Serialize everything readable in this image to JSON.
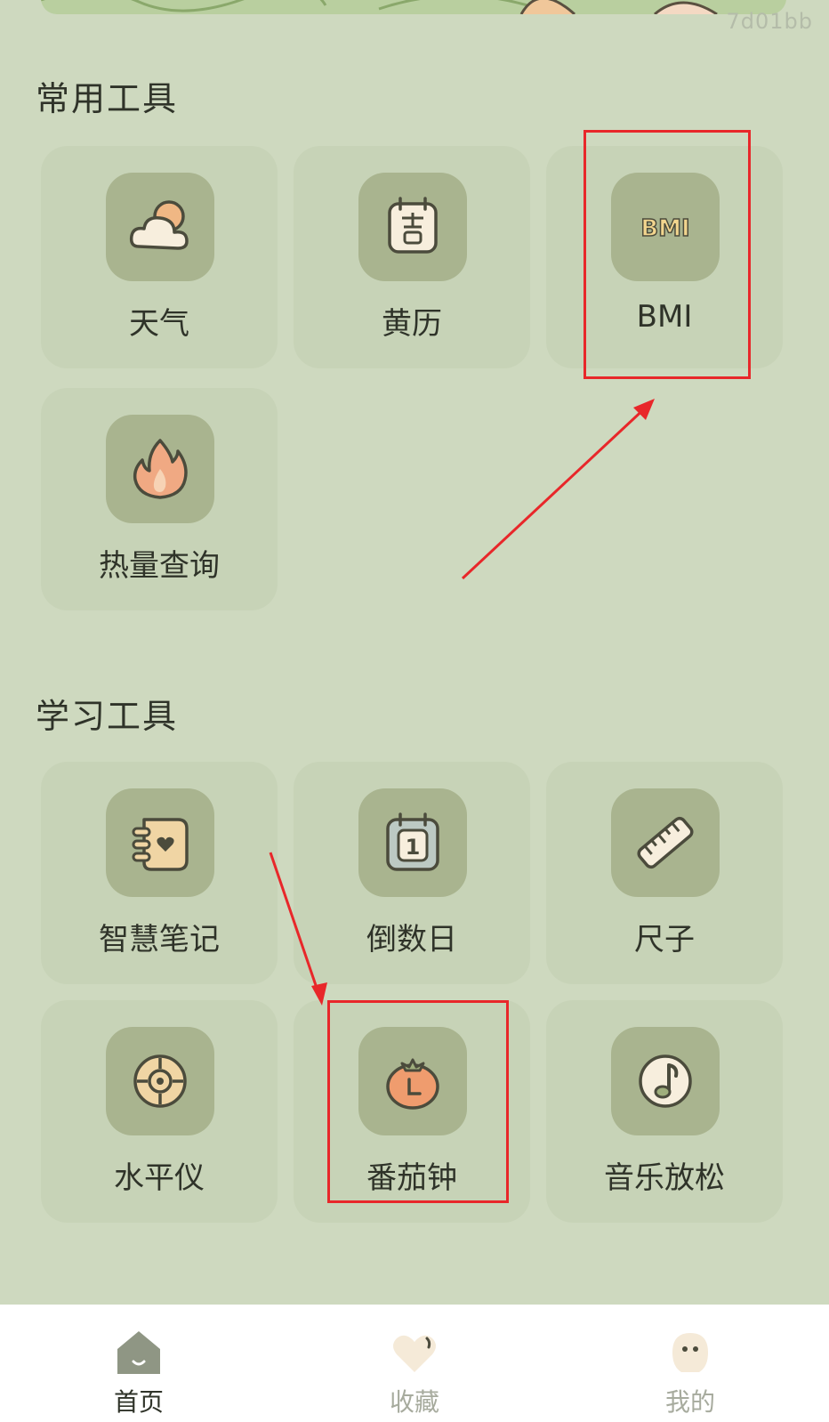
{
  "watermark": "7d01bb",
  "sections": [
    {
      "title": "常用工具",
      "tools": [
        {
          "label": "天气",
          "icon": "weather-cloud-sun-icon"
        },
        {
          "label": "黄历",
          "icon": "almanac-calendar-icon"
        },
        {
          "label": "BMI",
          "icon": "bmi-text-icon",
          "text": "BMI"
        },
        {
          "label": "热量查询",
          "icon": "calorie-flame-icon"
        }
      ]
    },
    {
      "title": "学习工具",
      "tools": [
        {
          "label": "智慧笔记",
          "icon": "smart-notes-icon"
        },
        {
          "label": "倒数日",
          "icon": "countdown-calendar-icon",
          "text": "1"
        },
        {
          "label": "尺子",
          "icon": "ruler-icon"
        },
        {
          "label": "水平仪",
          "icon": "level-target-icon"
        },
        {
          "label": "番茄钟",
          "icon": "tomato-clock-icon"
        },
        {
          "label": "音乐放松",
          "icon": "music-note-icon"
        }
      ]
    }
  ],
  "tabbar": [
    {
      "label": "首页",
      "icon": "home-icon",
      "active": true
    },
    {
      "label": "收藏",
      "icon": "heart-icon",
      "active": false
    },
    {
      "label": "我的",
      "icon": "profile-face-icon",
      "active": false
    }
  ],
  "colors": {
    "background": "#ced9bf",
    "tile": "#c7d3b7",
    "icon_box": "#a9b48f",
    "annotation_red": "#e8272a",
    "tab_active": "#2f3329",
    "tab_inactive": "#a7ab9e"
  }
}
